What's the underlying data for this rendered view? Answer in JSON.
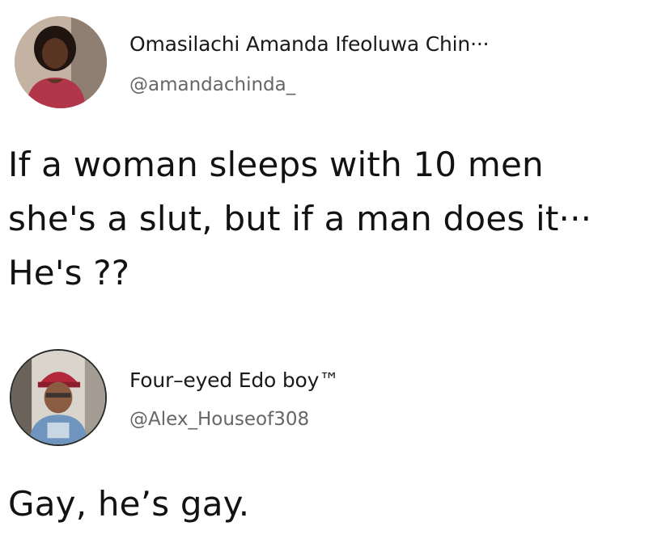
{
  "tweets": [
    {
      "display_name": "Omasilachi Amanda Ifeoluwa Chin···",
      "handle": "@amandachinda_",
      "avatar_icon": "profile-photo-woman",
      "text_lines": [
        "If a woman sleeps with 10 men",
        "she's a slut, but if a man does it···",
        "He's ??"
      ]
    },
    {
      "display_name": "Four–eyed Edo boy™",
      "handle": "@Alex_Houseof308",
      "avatar_icon": "profile-photo-man-red-cap",
      "text_lines": [
        "Gay, he’s gay."
      ]
    }
  ],
  "colors": {
    "background": "#ffffff",
    "text": "#121212",
    "handle": "#666666"
  }
}
